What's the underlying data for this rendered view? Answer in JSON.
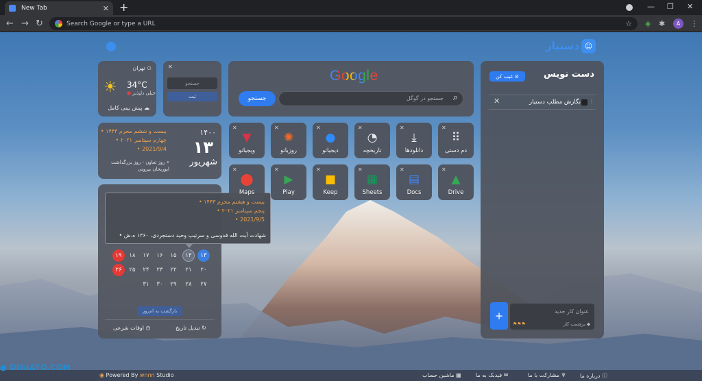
{
  "browser": {
    "tab_title": "New Tab",
    "omnibox_placeholder": "Search Google or type a URL",
    "avatar_letter": "A"
  },
  "header": {
    "logo_text": "دستیار"
  },
  "weather": {
    "city": "تهران",
    "temp": "34°C",
    "condition": "خیلی دلپذیر",
    "forecast_link": "پیش بینی کامل"
  },
  "quick_note": {
    "placeholder": "جستجو",
    "submit": "ثبت"
  },
  "search": {
    "logo": "Google",
    "placeholder": "جستجو در گوگل",
    "button": "جستجو"
  },
  "date_card": {
    "hijri": "بیست و ششم محرم ۱۴۴۳",
    "gregorian_text": "چهارم سپتامبر ۲۰۲۱",
    "gregorian": "2021/9/4",
    "year": "۱۴۰۰",
    "day": "۱۳",
    "month": "شهریور",
    "occasion": "روز تعاون - روز بزرگداشت ابوریحان بیرونی"
  },
  "tooltip": {
    "hijri": "بیست و هشتم محرم ۱۴۴۳",
    "gregorian_text": "پنجم سپتامبر ۲۰۲۱",
    "gregorian": "2021/9/5",
    "occasion": "شهادت آیت الله قدوسی و سرتیپ وحید دستجردی، ۱۳۶۰ ه.ش"
  },
  "calendar": {
    "row1": [
      "۱۹",
      "۱۸",
      "۱۷",
      "۱۶",
      "۱۵",
      "۱۴",
      "۱۳"
    ],
    "row2": [
      "۲۶",
      "۲۵",
      "۲۴",
      "۲۳",
      "۲۲",
      "۲۱",
      "۲۰"
    ],
    "row3": [
      "۳۱",
      "۳۰",
      "۲۹",
      "۲۸",
      "۲۷"
    ],
    "back_today": "بازگشت به امروز",
    "prayer_times": "اوقات شرعی",
    "convert_date": "تبدیل تاریخ"
  },
  "shortcuts": {
    "row1": [
      {
        "label": "دم دستی",
        "icon": "grid-icon",
        "color": "#e8eaed"
      },
      {
        "label": "دانلودها",
        "icon": "download-icon",
        "color": "#e8eaed"
      },
      {
        "label": "تاریخچه",
        "icon": "history-icon",
        "color": "#e8eaed"
      },
      {
        "label": "دیجیاتو",
        "icon": "digiato-icon",
        "color": "#2f8cff"
      },
      {
        "label": "روزیاتو",
        "icon": "zoomit-icon",
        "color": "#f06a27"
      },
      {
        "label": "ویجیاتو",
        "icon": "vigiato-icon",
        "color": "#d5344a"
      }
    ],
    "row2": [
      {
        "label": "Drive",
        "icon": "drive-icon",
        "color": "#34a853"
      },
      {
        "label": "Docs",
        "icon": "docs-icon",
        "color": "#4285f4"
      },
      {
        "label": "Sheets",
        "icon": "sheets-icon",
        "color": "#0f9d58"
      },
      {
        "label": "Keep",
        "icon": "keep-icon",
        "color": "#fbbc05"
      },
      {
        "label": "Play",
        "icon": "play-icon",
        "color": "#34a853"
      },
      {
        "label": "Maps",
        "icon": "maps-icon",
        "color": "#ea4335"
      }
    ]
  },
  "todo": {
    "title": "دست نویس",
    "hide_button": "غیب کن",
    "item": "نگارش مطلب دستیار",
    "new_task_placeholder": "عنوان کار جدید",
    "tag_label": "برچسب کار",
    "add": "+"
  },
  "footer": {
    "powered_by": "Powered By",
    "studio_brand": "wnnn",
    "studio": "Studio",
    "watermark": "DIGIATO.COM",
    "about": "درباره ما",
    "contribute": "مشارکت با ما",
    "feedback": "فیدبک به ما",
    "calculator": "ماشین حساب"
  }
}
